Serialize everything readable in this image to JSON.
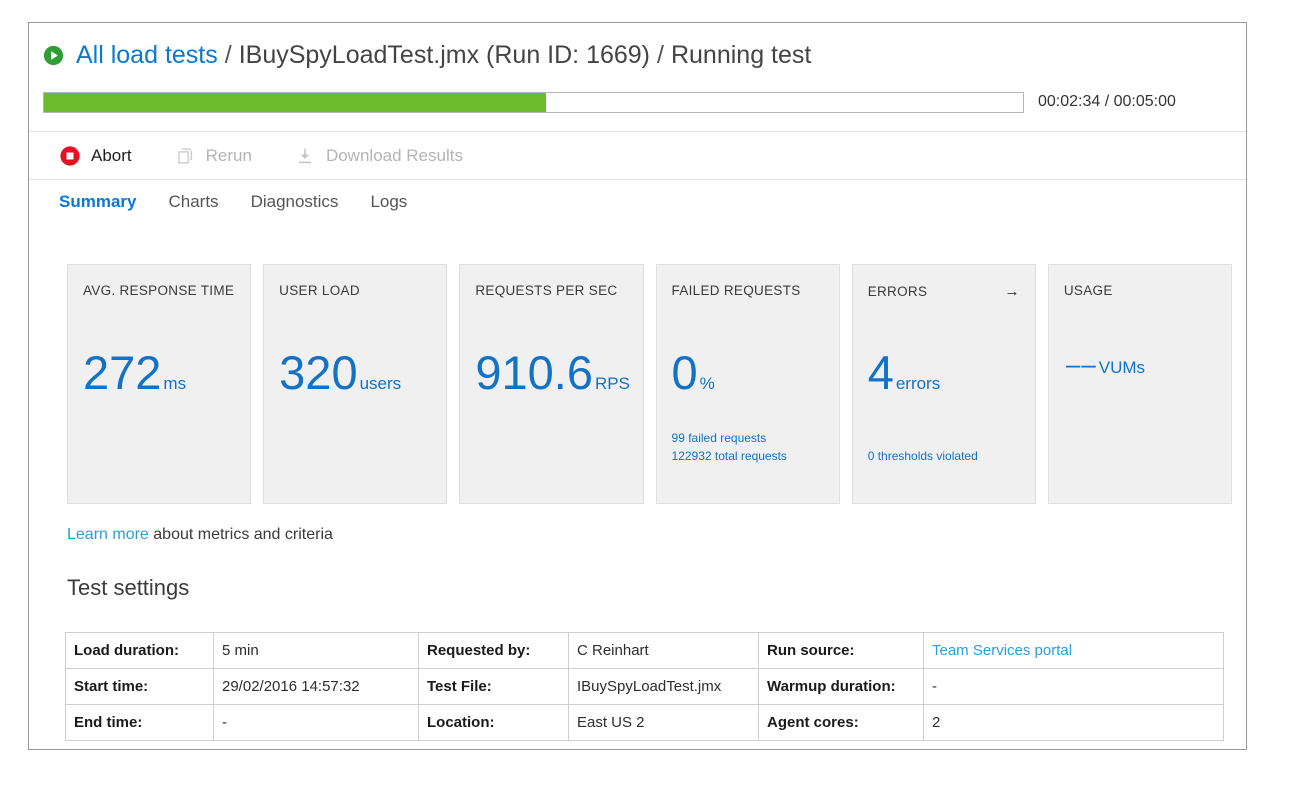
{
  "header": {
    "play_icon": "play-circle-icon",
    "breadcrumb": {
      "root_label": "All load tests",
      "separator_1": "/",
      "test_label": "IBuySpyLoadTest.jmx (Run ID: 1669)",
      "separator_2": "/",
      "status_label": "Running test"
    }
  },
  "progress": {
    "percent": 51.3,
    "elapsed_total": "00:02:34 / 00:05:00",
    "fill_color": "#6cbb2d"
  },
  "toolbar": {
    "abort": {
      "label": "Abort",
      "icon": "stop-circle-icon",
      "enabled": true
    },
    "rerun": {
      "label": "Rerun",
      "icon": "copy-icon",
      "enabled": false
    },
    "download": {
      "label": "Download Results",
      "icon": "download-icon",
      "enabled": false
    }
  },
  "tabs": [
    {
      "label": "Summary",
      "active": true
    },
    {
      "label": "Charts",
      "active": false
    },
    {
      "label": "Diagnostics",
      "active": false
    },
    {
      "label": "Logs",
      "active": false
    }
  ],
  "cards": [
    {
      "title": "AVG. RESPONSE TIME",
      "value": "272",
      "unit": "ms",
      "sub": "",
      "arrow": ""
    },
    {
      "title": "USER LOAD",
      "value": "320",
      "unit": "users",
      "sub": "",
      "arrow": ""
    },
    {
      "title": "REQUESTS PER SEC",
      "value": "910.6",
      "unit": "RPS",
      "sub": "",
      "arrow": ""
    },
    {
      "title": "FAILED REQUESTS",
      "value": "0",
      "unit": "%",
      "sub_line1": "99 failed requests",
      "sub_line2": "122932 total requests",
      "arrow": ""
    },
    {
      "title": "ERRORS",
      "value": "4",
      "unit": "errors",
      "sub_line1": "0 thresholds violated",
      "arrow": "→",
      "arrow_icon": "arrow-right-icon"
    },
    {
      "title": "USAGE",
      "value": "––",
      "unit": "VUMs",
      "sub": "",
      "arrow": ""
    }
  ],
  "learn_more": {
    "link_label": "Learn more",
    "rest_text": " about metrics and criteria"
  },
  "settings": {
    "title": "Test settings",
    "rows": [
      {
        "label1": "Load duration:",
        "value1": "5 min",
        "label2": "Requested by:",
        "value2": "C Reinhart",
        "label3": "Run source:",
        "value3": "Team Services portal",
        "value3_is_link": true
      },
      {
        "label1": "Start time:",
        "value1": "29/02/2016 14:57:32",
        "label2": "Test File:",
        "value2": "IBuySpyLoadTest.jmx",
        "label3": "Warmup duration:",
        "value3": "-",
        "value3_is_link": false
      },
      {
        "label1": "End time:",
        "value1": "-",
        "label2": "Location:",
        "value2": "East US 2",
        "label3": "Agent cores:",
        "value3": "2",
        "value3_is_link": false
      }
    ]
  },
  "colors": {
    "accent_blue": "#0a78d4",
    "value_blue": "#1272c8",
    "link_blue": "#2e9bdd",
    "progress_green": "#6cbb2d",
    "abort_red": "#e81123",
    "play_green": "#2f9e35"
  }
}
